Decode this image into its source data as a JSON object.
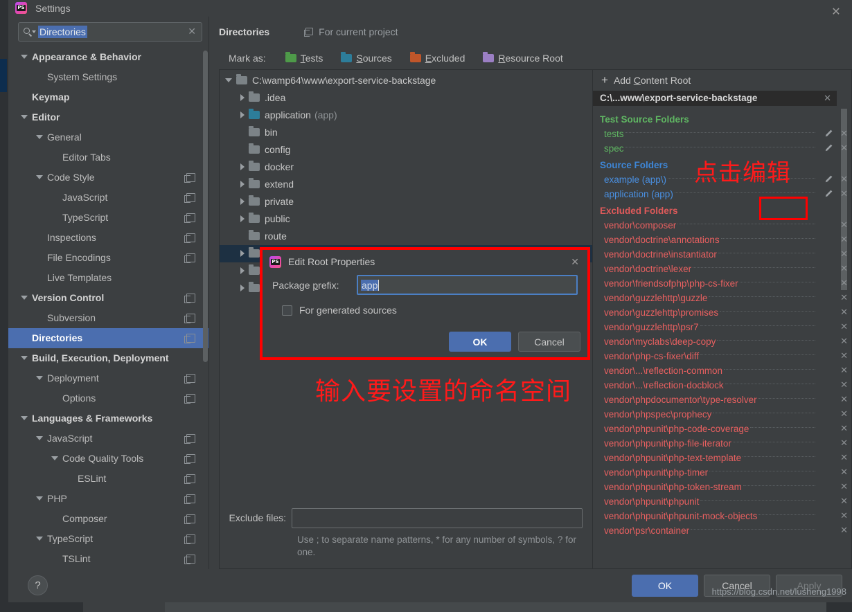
{
  "window": {
    "title": "Settings",
    "app_icon": "phpstorm-icon",
    "close_label": "✕"
  },
  "search": {
    "value": "Directories",
    "clear_label": "✕",
    "icon": "search-icon"
  },
  "sidebar": {
    "items": [
      {
        "label": "Appearance & Behavior",
        "indent": 0,
        "arrow": "down",
        "bold": true,
        "copy": false,
        "selected": false
      },
      {
        "label": "System Settings",
        "indent": 1,
        "arrow": "none",
        "bold": false,
        "copy": false,
        "selected": false
      },
      {
        "label": "Keymap",
        "indent": 0,
        "arrow": "none",
        "bold": true,
        "copy": false,
        "selected": false
      },
      {
        "label": "Editor",
        "indent": 0,
        "arrow": "down",
        "bold": true,
        "copy": false,
        "selected": false
      },
      {
        "label": "General",
        "indent": 1,
        "arrow": "down",
        "bold": false,
        "copy": false,
        "selected": false
      },
      {
        "label": "Editor Tabs",
        "indent": 2,
        "arrow": "none",
        "bold": false,
        "copy": false,
        "selected": false
      },
      {
        "label": "Code Style",
        "indent": 1,
        "arrow": "down",
        "bold": false,
        "copy": true,
        "selected": false
      },
      {
        "label": "JavaScript",
        "indent": 2,
        "arrow": "none",
        "bold": false,
        "copy": true,
        "selected": false
      },
      {
        "label": "TypeScript",
        "indent": 2,
        "arrow": "none",
        "bold": false,
        "copy": true,
        "selected": false
      },
      {
        "label": "Inspections",
        "indent": 1,
        "arrow": "none",
        "bold": false,
        "copy": true,
        "selected": false
      },
      {
        "label": "File Encodings",
        "indent": 1,
        "arrow": "none",
        "bold": false,
        "copy": true,
        "selected": false
      },
      {
        "label": "Live Templates",
        "indent": 1,
        "arrow": "none",
        "bold": false,
        "copy": false,
        "selected": false
      },
      {
        "label": "Version Control",
        "indent": 0,
        "arrow": "down",
        "bold": true,
        "copy": true,
        "selected": false
      },
      {
        "label": "Subversion",
        "indent": 1,
        "arrow": "none",
        "bold": false,
        "copy": true,
        "selected": false
      },
      {
        "label": "Directories",
        "indent": 0,
        "arrow": "none",
        "bold": true,
        "copy": true,
        "selected": true
      },
      {
        "label": "Build, Execution, Deployment",
        "indent": 0,
        "arrow": "down",
        "bold": true,
        "copy": false,
        "selected": false
      },
      {
        "label": "Deployment",
        "indent": 1,
        "arrow": "down",
        "bold": false,
        "copy": true,
        "selected": false
      },
      {
        "label": "Options",
        "indent": 2,
        "arrow": "none",
        "bold": false,
        "copy": true,
        "selected": false
      },
      {
        "label": "Languages & Frameworks",
        "indent": 0,
        "arrow": "down",
        "bold": true,
        "copy": false,
        "selected": false
      },
      {
        "label": "JavaScript",
        "indent": 1,
        "arrow": "down",
        "bold": false,
        "copy": true,
        "selected": false
      },
      {
        "label": "Code Quality Tools",
        "indent": 2,
        "arrow": "down",
        "bold": false,
        "copy": true,
        "selected": false
      },
      {
        "label": "ESLint",
        "indent": 3,
        "arrow": "none",
        "bold": false,
        "copy": true,
        "selected": false
      },
      {
        "label": "PHP",
        "indent": 1,
        "arrow": "down",
        "bold": false,
        "copy": true,
        "selected": false
      },
      {
        "label": "Composer",
        "indent": 2,
        "arrow": "none",
        "bold": false,
        "copy": true,
        "selected": false
      },
      {
        "label": "TypeScript",
        "indent": 1,
        "arrow": "down",
        "bold": false,
        "copy": true,
        "selected": false
      },
      {
        "label": "TSLint",
        "indent": 2,
        "arrow": "none",
        "bold": false,
        "copy": true,
        "selected": false
      }
    ]
  },
  "main": {
    "title": "Directories",
    "for_project": "For current project",
    "mark_as_label": "Mark as:",
    "mark_as": [
      {
        "label": "Tests",
        "accel": "T",
        "color": "#4e9a49"
      },
      {
        "label": "Sources",
        "accel": "S",
        "color": "#2d7d9a"
      },
      {
        "label": "Excluded",
        "accel": "E",
        "color": "#c0562a"
      },
      {
        "label": "Resource Root",
        "accel": "R",
        "color": "#9b7fc4"
      }
    ]
  },
  "dir_tree": [
    {
      "label": "C:\\wamp64\\www\\export-service-backstage",
      "suffix": "",
      "indent": 0,
      "arrow": "down",
      "color": "gray",
      "selected": false
    },
    {
      "label": ".idea",
      "suffix": "",
      "indent": 1,
      "arrow": "right",
      "color": "gray",
      "selected": false
    },
    {
      "label": "application",
      "suffix": "(app)",
      "indent": 1,
      "arrow": "right",
      "color": "blue",
      "selected": false
    },
    {
      "label": "bin",
      "suffix": "",
      "indent": 1,
      "arrow": "none",
      "color": "gray",
      "selected": false
    },
    {
      "label": "config",
      "suffix": "",
      "indent": 1,
      "arrow": "none",
      "color": "gray",
      "selected": false
    },
    {
      "label": "docker",
      "suffix": "",
      "indent": 1,
      "arrow": "right",
      "color": "gray",
      "selected": false
    },
    {
      "label": "extend",
      "suffix": "",
      "indent": 1,
      "arrow": "right",
      "color": "gray",
      "selected": false
    },
    {
      "label": "private",
      "suffix": "",
      "indent": 1,
      "arrow": "right",
      "color": "gray",
      "selected": false
    },
    {
      "label": "public",
      "suffix": "",
      "indent": 1,
      "arrow": "right",
      "color": "gray",
      "selected": false
    },
    {
      "label": "route",
      "suffix": "",
      "indent": 1,
      "arrow": "none",
      "color": "gray",
      "selected": false
    },
    {
      "label": "",
      "suffix": "",
      "indent": 1,
      "arrow": "right",
      "color": "gray",
      "selected": true
    },
    {
      "label": "",
      "suffix": "",
      "indent": 1,
      "arrow": "right",
      "color": "gray",
      "selected": false
    },
    {
      "label": "",
      "suffix": "",
      "indent": 1,
      "arrow": "right",
      "color": "gray",
      "selected": false
    }
  ],
  "exclude_files": {
    "label": "Exclude files:",
    "value": "",
    "hint": "Use ; to separate name patterns, * for any number of symbols, ? for one."
  },
  "right_panel": {
    "add_content_root": "Add Content Root",
    "add_accel": "C",
    "root_path": "C:\\...www\\export-service-backstage",
    "root_close": "✕",
    "groups": [
      {
        "title": "Test Source Folders",
        "kind": "test",
        "items": [
          {
            "name": "tests",
            "pencil": true,
            "close": true,
            "highlight": false
          },
          {
            "name": "spec",
            "pencil": true,
            "close": true,
            "highlight": false
          }
        ]
      },
      {
        "title": "Source Folders",
        "kind": "src",
        "items": [
          {
            "name": "example (app\\)",
            "pencil": true,
            "close": true,
            "highlight": false
          },
          {
            "name": "application (app)",
            "pencil": true,
            "close": true,
            "highlight": true
          }
        ]
      },
      {
        "title": "Excluded Folders",
        "kind": "exc",
        "items": [
          {
            "name": "vendor\\composer",
            "pencil": false,
            "close": true,
            "highlight": false
          },
          {
            "name": "vendor\\doctrine\\annotations",
            "pencil": false,
            "close": true,
            "highlight": false
          },
          {
            "name": "vendor\\doctrine\\instantiator",
            "pencil": false,
            "close": true,
            "highlight": false
          },
          {
            "name": "vendor\\doctrine\\lexer",
            "pencil": false,
            "close": true,
            "highlight": false
          },
          {
            "name": "vendor\\friendsofphp\\php-cs-fixer",
            "pencil": false,
            "close": true,
            "highlight": false
          },
          {
            "name": "vendor\\guzzlehttp\\guzzle",
            "pencil": false,
            "close": true,
            "highlight": false
          },
          {
            "name": "vendor\\guzzlehttp\\promises",
            "pencil": false,
            "close": true,
            "highlight": false
          },
          {
            "name": "vendor\\guzzlehttp\\psr7",
            "pencil": false,
            "close": true,
            "highlight": false
          },
          {
            "name": "vendor\\myclabs\\deep-copy",
            "pencil": false,
            "close": true,
            "highlight": false
          },
          {
            "name": "vendor\\php-cs-fixer\\diff",
            "pencil": false,
            "close": true,
            "highlight": false
          },
          {
            "name": "vendor\\...\\reflection-common",
            "pencil": false,
            "close": true,
            "highlight": false
          },
          {
            "name": "vendor\\...\\reflection-docblock",
            "pencil": false,
            "close": true,
            "highlight": false
          },
          {
            "name": "vendor\\phpdocumentor\\type-resolver",
            "pencil": false,
            "close": true,
            "highlight": false
          },
          {
            "name": "vendor\\phpspec\\prophecy",
            "pencil": false,
            "close": true,
            "highlight": false
          },
          {
            "name": "vendor\\phpunit\\php-code-coverage",
            "pencil": false,
            "close": true,
            "highlight": false
          },
          {
            "name": "vendor\\phpunit\\php-file-iterator",
            "pencil": false,
            "close": true,
            "highlight": false
          },
          {
            "name": "vendor\\phpunit\\php-text-template",
            "pencil": false,
            "close": true,
            "highlight": false
          },
          {
            "name": "vendor\\phpunit\\php-timer",
            "pencil": false,
            "close": true,
            "highlight": false
          },
          {
            "name": "vendor\\phpunit\\php-token-stream",
            "pencil": false,
            "close": true,
            "highlight": false
          },
          {
            "name": "vendor\\phpunit\\phpunit",
            "pencil": false,
            "close": true,
            "highlight": false
          },
          {
            "name": "vendor\\phpunit\\phpunit-mock-objects",
            "pencil": false,
            "close": true,
            "highlight": false
          },
          {
            "name": "vendor\\psr\\container",
            "pencil": false,
            "close": true,
            "highlight": false
          }
        ]
      }
    ]
  },
  "modal": {
    "title": "Edit Root Properties",
    "close": "✕",
    "package_prefix_label": "Package prefix:",
    "package_prefix_accel": "p",
    "package_prefix_value": "app",
    "checkbox_label": "For generated sources",
    "checkbox_accel": "g",
    "checkbox_checked": false,
    "ok": "OK",
    "cancel": "Cancel"
  },
  "footer": {
    "help": "?",
    "ok": "OK",
    "cancel": "Cancel",
    "apply": "Apply",
    "watermark": "https://blog.csdn.net/lusheng1998"
  },
  "annotations": {
    "click_to_edit": "点击编辑",
    "input_namespace": "输入要设置的命名空间",
    "color": "#ff0000"
  }
}
